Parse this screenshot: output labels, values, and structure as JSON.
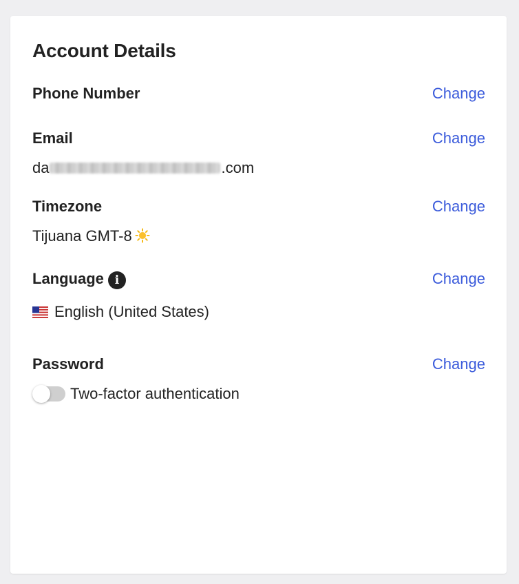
{
  "title": "Account Details",
  "change_label": "Change",
  "phone": {
    "label": "Phone Number"
  },
  "email": {
    "label": "Email",
    "value_prefix": "da",
    "value_suffix": ".com"
  },
  "timezone": {
    "label": "Timezone",
    "value": "Tijuana GMT-8",
    "icon": "sun-icon"
  },
  "language": {
    "label": "Language",
    "info_icon": "info-icon",
    "value": "English (United States)",
    "flag_icon": "us-flag-icon"
  },
  "password": {
    "label": "Password"
  },
  "two_factor": {
    "label": "Two-factor authentication",
    "enabled": false
  },
  "colors": {
    "link": "#3b5bdb",
    "text": "#222222",
    "toggle_off": "#cfcfcf"
  }
}
